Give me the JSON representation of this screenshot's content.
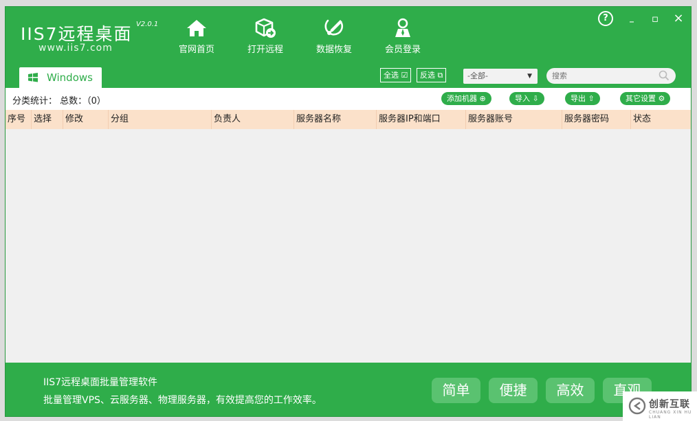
{
  "app": {
    "logo_text": "IIS7远程桌面",
    "version": "V2.0.1",
    "url": "www.iis7.com"
  },
  "nav": [
    {
      "label": "官网首页",
      "icon": "home-icon"
    },
    {
      "label": "打开远程",
      "icon": "remote-box-icon"
    },
    {
      "label": "数据恢复",
      "icon": "wrench-icon"
    },
    {
      "label": "会员登录",
      "icon": "user-icon"
    }
  ],
  "window_controls": {
    "help": "?",
    "minimize": "–",
    "maximize": "▫",
    "close": "×"
  },
  "tab": {
    "label": "Windows",
    "icon": "windows-logo-icon"
  },
  "selection": {
    "select_all": "全选",
    "invert": "反选"
  },
  "group_select": {
    "value": "-全部-"
  },
  "search": {
    "placeholder": "搜索"
  },
  "stats": {
    "label": "分类统计： 总数：（0）"
  },
  "toolbar": {
    "add": "添加机器",
    "import": "导入",
    "export": "导出",
    "settings": "其它设置"
  },
  "table": {
    "columns": [
      "序号",
      "选择",
      "修改",
      "分组",
      "负责人",
      "服务器名称",
      "服务器IP和端口",
      "服务器账号",
      "服务器密码",
      "状态"
    ],
    "rows": []
  },
  "footer": {
    "title": "IIS7远程桌面批量管理软件",
    "description": "批量管理VPS、云服务器、物理服务器，有效提高您的工作效率。",
    "features": [
      "简单",
      "便捷",
      "高效",
      "直观"
    ]
  },
  "watermark": {
    "text": "创新互联",
    "sub": "CHUANG XIN HU LIAN"
  },
  "colors": {
    "primary": "#2fad4a",
    "header_row": "#fbe1ca",
    "panel": "#f0f0f0"
  }
}
